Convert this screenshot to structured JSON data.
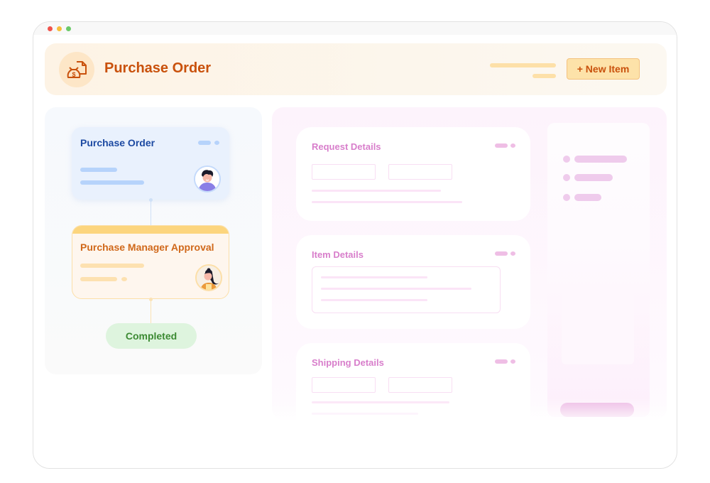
{
  "window": {
    "controls": [
      "close",
      "minimize",
      "maximize"
    ]
  },
  "header": {
    "icon": "money-bag-document-icon",
    "title": "Purchase Order",
    "new_item_label": "+ New Item"
  },
  "workflow": {
    "steps": [
      {
        "title": "Purchase Order",
        "avatar": "man-avatar",
        "accent": "#1d4aa2"
      },
      {
        "title": "Purchase Manager Approval",
        "avatar": "woman-avatar",
        "accent": "#d0681a"
      }
    ],
    "status": "Completed"
  },
  "form": {
    "sections": [
      {
        "title": "Request Details"
      },
      {
        "title": "Item Details"
      },
      {
        "title": "Shipping Details"
      }
    ]
  },
  "colors": {
    "brand_orange": "#c9510c",
    "po_blue": "#1d4aa2",
    "approval_orange": "#d0681a",
    "completed_green": "#3c8a33",
    "section_pink": "#d87ecb"
  }
}
